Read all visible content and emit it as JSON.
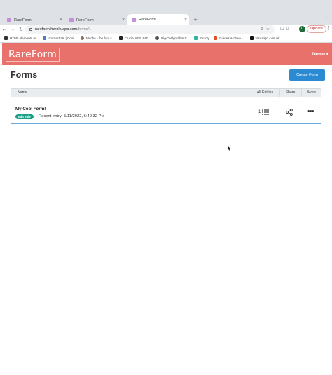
{
  "browser": {
    "tabs": [
      {
        "label": "RareForm",
        "active": false
      },
      {
        "label": "RareForm",
        "active": false
      },
      {
        "label": "RareForm",
        "active": true
      }
    ],
    "new_tab_label": "+",
    "close_label": "×",
    "tab_menu_label": "⌄",
    "url_host": "rareform.herokuapp.com",
    "url_path": "/forms/1",
    "profile_initial": "C",
    "update_label": "Update",
    "menu_label": "⋮"
  },
  "bookmarks": [
    {
      "label": "HTML elements re...",
      "color": "#333333"
    },
    {
      "label": "Contact Us | Covi...",
      "color": "#4a7fc1"
    },
    {
      "label": "Mocha - the fun, s...",
      "color": "#8d6e63"
    },
    {
      "label": "Crucial 8GB 64G...",
      "color": "#222222"
    },
    {
      "label": "Big-O Algorithm C...",
      "color": "#555555"
    },
    {
      "label": "Structy",
      "color": "#2bb3a3"
    },
    {
      "label": "Guides Archive -...",
      "color": "#e34c26"
    },
    {
      "label": "VisuAlgo - visuali...",
      "color": "#111111"
    }
  ],
  "app": {
    "logo": "RareForm",
    "user_menu": "Demo ▾",
    "accent_color": "#e8726b"
  },
  "page": {
    "title": "Forms",
    "create_button": "Create Form",
    "columns": {
      "name": "Name",
      "entries": "All Entries",
      "share": "Share",
      "more": "More"
    },
    "forms": [
      {
        "name": "My Cool Form!",
        "edit_label": "Edit Title",
        "recent_entry": "Recent entry: 5/11/2022, 6:40:32 PM",
        "entries": "1"
      }
    ]
  }
}
